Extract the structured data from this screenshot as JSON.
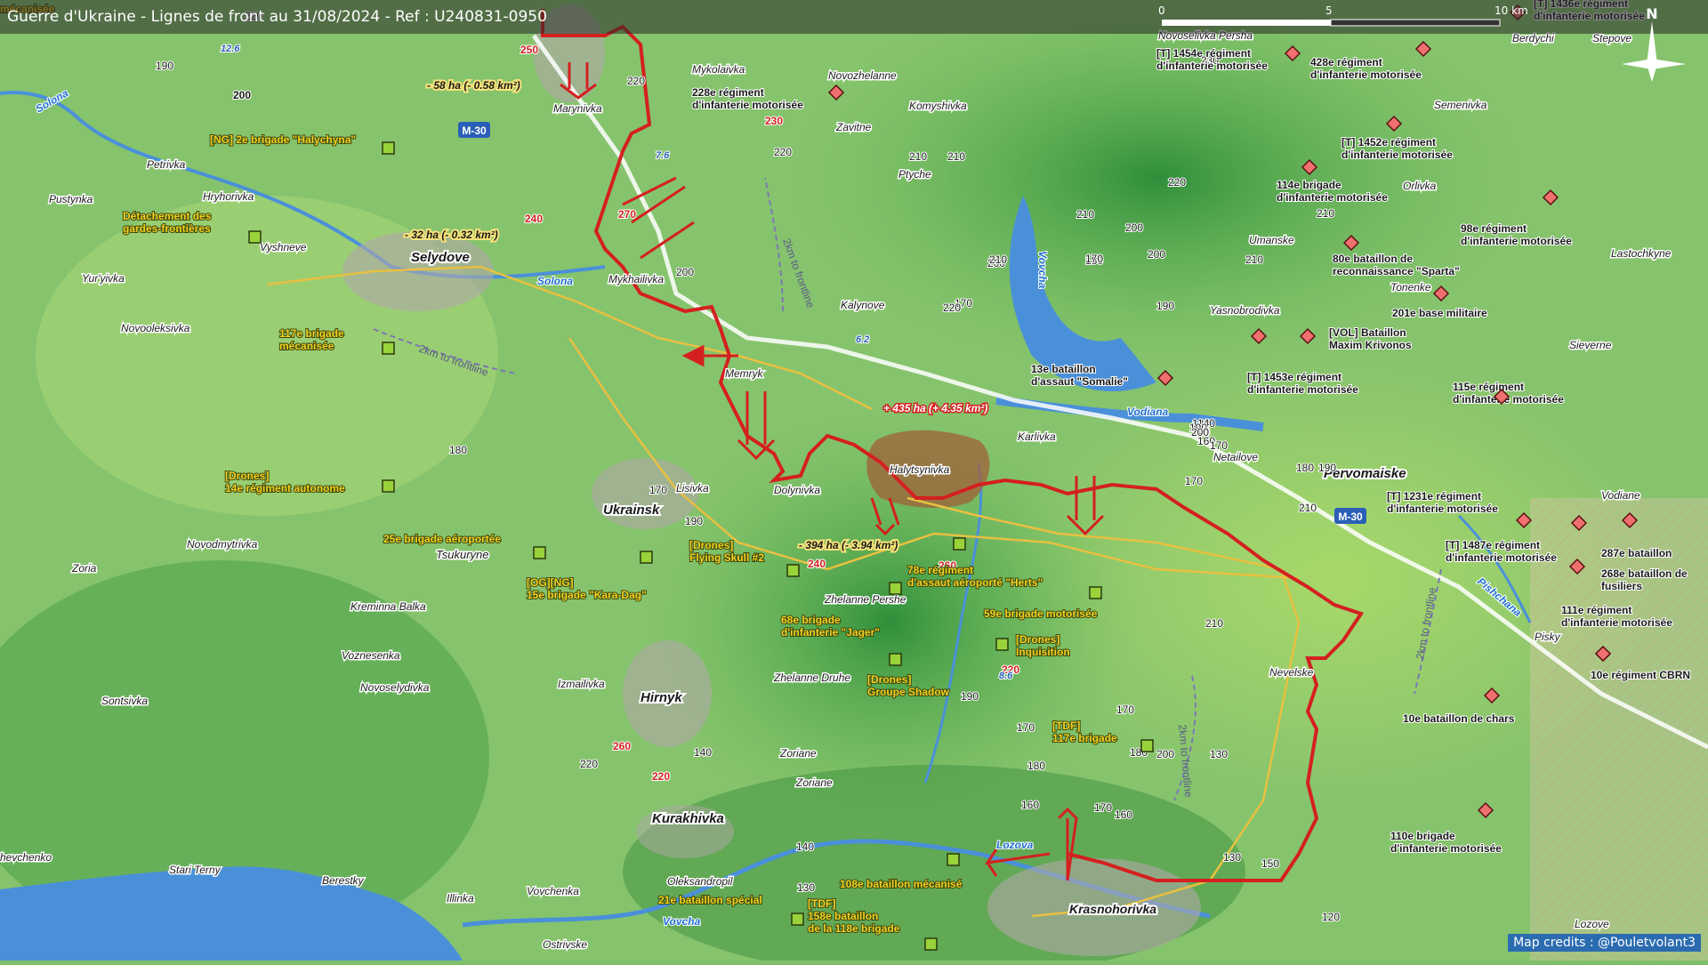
{
  "title": "Guerre d'Ukraine - Lignes de front au 31/08/2024 - Ref : U240831-0950",
  "credits": "Map credits : @Pouletvolant3",
  "scale": {
    "ticks": [
      "0",
      "5",
      "10 km"
    ]
  },
  "compass": "N",
  "colors": {
    "front": "#d42020",
    "road": "#e8c040",
    "river": "#3a8fd8",
    "unit": "#9ad23a",
    "enemy": "#f07070"
  },
  "towns": [
    {
      "name": "Selydove"
    },
    {
      "name": "Ukrainsk"
    },
    {
      "name": "Hirnyk"
    },
    {
      "name": "Kurakhivka"
    },
    {
      "name": "Krasnohorivka"
    },
    {
      "name": "Halytsynivka"
    },
    {
      "name": "Marynivka"
    },
    {
      "name": "Mykhailivka"
    },
    {
      "name": "Memryk"
    },
    {
      "name": "Tsukuryne"
    },
    {
      "name": "Zhelanne Pershe"
    },
    {
      "name": "Zhelanne Druhe"
    },
    {
      "name": "Nevelske"
    },
    {
      "name": "Karlivka"
    },
    {
      "name": "Netailove"
    },
    {
      "name": "Pervomaiske"
    },
    {
      "name": "Lisivka"
    },
    {
      "name": "Dolynivka"
    },
    {
      "name": "Zoriane"
    },
    {
      "name": "Oleksandropil"
    },
    {
      "name": "Vovchenka"
    },
    {
      "name": "Illinka"
    },
    {
      "name": "Ostrivske"
    },
    {
      "name": "Berestky"
    },
    {
      "name": "Stari Terny"
    },
    {
      "name": "Sontsivka"
    },
    {
      "name": "Voznesenka"
    },
    {
      "name": "Novoselydivka"
    },
    {
      "name": "Izmailivka"
    },
    {
      "name": "Kreminna Balka"
    },
    {
      "name": "Novodmytrivka"
    },
    {
      "name": "Zoria"
    },
    {
      "name": "Vyshneve"
    },
    {
      "name": "Yur'yivka"
    },
    {
      "name": "Novooleksivka"
    },
    {
      "name": "Pustynka"
    },
    {
      "name": "Petrivka"
    },
    {
      "name": "Hryhorivka"
    },
    {
      "name": "Mykolaivka"
    },
    {
      "name": "Novozhelanne"
    },
    {
      "name": "Komyshivka"
    },
    {
      "name": "Zavitne"
    },
    {
      "name": "Ptyche"
    },
    {
      "name": "Kalynove"
    },
    {
      "name": "Novoselivka Persha"
    },
    {
      "name": "Berdychi"
    },
    {
      "name": "Stepove"
    },
    {
      "name": "Semenivka"
    },
    {
      "name": "Orlivka"
    },
    {
      "name": "Umanske"
    },
    {
      "name": "Lastochkyne"
    },
    {
      "name": "Tonenke"
    },
    {
      "name": "Yasnobrodivka"
    },
    {
      "name": "Sieverne"
    },
    {
      "name": "Vodiane"
    },
    {
      "name": "Pisky"
    },
    {
      "name": "Lozove"
    },
    {
      "name": "Zoriane"
    },
    {
      "name": "hevchenko"
    }
  ],
  "water_labels": [
    "Solona",
    "Solona",
    "Vovcha",
    "Vodiana",
    "Lozova",
    "Vovcha",
    "Pishchana"
  ],
  "area_labels": [
    {
      "text": "- 58 ha (- 0.58 km²)"
    },
    {
      "text": "- 32 ha (- 0.32 km²)"
    },
    {
      "text": "+ 435 ha (+ 4.35 km²)"
    },
    {
      "text": "- 394 ha (- 3.94 km²)"
    }
  ],
  "ua_units": [
    "[NG] 2e brigade \"Halychyna\"",
    "Détachement des|gardes-frontières",
    "117e brigade|mécanisée",
    "[Drones]|14e régiment autonome",
    "25e brigade aéroportée",
    "[OG][NG]|15e brigade \"Kara-Dag\"",
    "[Drones]|Flying Skull #2",
    "78e régiment|d'assaut aéroporté \"Herts\"",
    "68e brigade|d'infanterie \"Jager\"",
    "59e brigade motorisée",
    "[Drones]|Inquisition",
    "[Drones]|Groupe Shadow",
    "[TDF]|117e brigade",
    "108e bataillon mécanisé",
    "21e bataillon spécial",
    "[TDF]|158e bataillon|de la 118e brigade",
    "mécanisée"
  ],
  "ru_units": [
    "228e régiment|d'infanterie motorisée",
    "[T] 1454e régiment|d'infanterie motorisée",
    "428e régiment|d'infanterie motorisée",
    "[T] 1452e régiment|d'infanterie motorisée",
    "114e brigade|d'infanterie motorisée",
    "98e régiment|d'infanterie motorisée",
    "80e bataillon de|reconnaissance \"Sparta\"",
    "201e base militaire",
    "[VOL] Bataillon|Maxim Krivonos",
    "[T] 1453e régiment|d'infanterie motorisée",
    "13e bataillon|d'assaut \"Somalie\"",
    "115e régiment|d'infanterie motorisée",
    "[T] 1231e régiment|d'infanterie motorisée",
    "[T] 1487e régiment|d'infanterie motorisée",
    "287e bataillon",
    "268e bataillon de|fusiliers",
    "111e régiment|d'infanterie motorisée",
    "10e régiment CBRN",
    "10e bataillon de chars",
    "110e brigade|d'infanterie motorisée",
    "[T] 1436e régiment|d'infanterie motorisée"
  ],
  "roads": [
    "M-30",
    "M-30"
  ],
  "road_numbers": [
    "12.6",
    "7.6",
    "6.2",
    "8.6"
  ],
  "frontline_labels": [
    "2km to frontline",
    "2km to frontline",
    "2km to frontline",
    "2km to frontline"
  ],
  "elevations": [
    "190",
    "200",
    "220",
    "250",
    "220",
    "240",
    "270",
    "200",
    "230",
    "220",
    "210",
    "200",
    "210",
    "170",
    "210",
    "220",
    "230",
    "220",
    "210",
    "200",
    "210",
    "180",
    "170",
    "190",
    "210",
    "200",
    "180",
    "170",
    "190",
    "240",
    "260",
    "220",
    "210",
    "130",
    "170",
    "180",
    "200",
    "190",
    "160",
    "170",
    "180",
    "160",
    "170",
    "130",
    "150",
    "120",
    "260",
    "220",
    "220",
    "140",
    "130",
    "140",
    "140",
    "130",
    "140",
    "190",
    "200",
    "160",
    "170",
    "180",
    "190",
    "170",
    "210"
  ]
}
